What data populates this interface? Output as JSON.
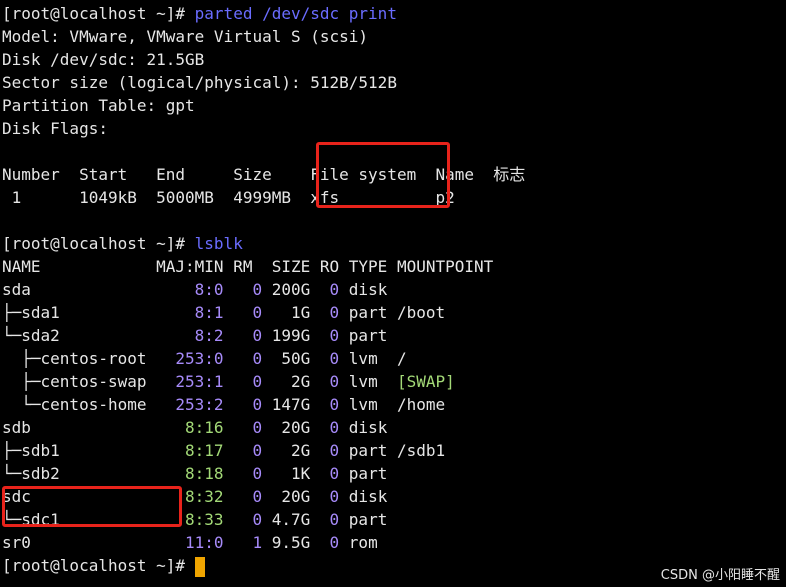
{
  "prompt": "[root@localhost ~]# ",
  "cmd1": "parted /dev/sdc print",
  "parted": {
    "model": "Model: VMware, VMware Virtual S (scsi)",
    "disk": "Disk /dev/sdc: 21.5GB",
    "sector": "Sector size (logical/physical): 512B/512B",
    "ptable": "Partition Table: gpt",
    "flags": "Disk Flags:",
    "header": "Number  Start   End     Size    File system  Name  标志",
    "row": " 1      1049kB  5000MB  4999MB  xfs          p2"
  },
  "cmd2": "lsblk",
  "lsblk": {
    "header": "NAME            MAJ:MIN RM  SIZE RO TYPE MOUNTPOINT",
    "rows": [
      {
        "name": "sda",
        "majmin": "8:0",
        "rm": "0",
        "size": "200G",
        "ro": "0",
        "type": "disk",
        "mount": ""
      },
      {
        "name": "├─sda1",
        "majmin": "8:1",
        "rm": "0",
        "size": "1G",
        "ro": "0",
        "type": "part",
        "mount": "/boot"
      },
      {
        "name": "└─sda2",
        "majmin": "8:2",
        "rm": "0",
        "size": "199G",
        "ro": "0",
        "type": "part",
        "mount": ""
      },
      {
        "name": "  ├─centos-root",
        "majmin": "253:0",
        "rm": "0",
        "size": "50G",
        "ro": "0",
        "type": "lvm",
        "mount": "/"
      },
      {
        "name": "  ├─centos-swap",
        "majmin": "253:1",
        "rm": "0",
        "size": "2G",
        "ro": "0",
        "type": "lvm",
        "mount": "[SWAP]"
      },
      {
        "name": "  └─centos-home",
        "majmin": "253:2",
        "rm": "0",
        "size": "147G",
        "ro": "0",
        "type": "lvm",
        "mount": "/home"
      },
      {
        "name": "sdb",
        "majmin": "8:16",
        "rm": "0",
        "size": "20G",
        "ro": "0",
        "type": "disk",
        "mount": ""
      },
      {
        "name": "├─sdb1",
        "majmin": "8:17",
        "rm": "0",
        "size": "2G",
        "ro": "0",
        "type": "part",
        "mount": "/sdb1"
      },
      {
        "name": "└─sdb2",
        "majmin": "8:18",
        "rm": "0",
        "size": "1K",
        "ro": "0",
        "type": "part",
        "mount": ""
      },
      {
        "name": "sdc",
        "majmin": "8:32",
        "rm": "0",
        "size": "20G",
        "ro": "0",
        "type": "disk",
        "mount": ""
      },
      {
        "name": "└─sdc1",
        "majmin": "8:33",
        "rm": "0",
        "size": "4.7G",
        "ro": "0",
        "type": "part",
        "mount": ""
      },
      {
        "name": "sr0",
        "majmin": "11:0",
        "rm": "1",
        "size": "9.5G",
        "ro": "0",
        "type": "rom",
        "mount": ""
      }
    ]
  },
  "watermark": "CSDN @小阳睡不醒",
  "colors": {
    "command": "#6a6cff",
    "number": "#a78bfa",
    "highlight": "#e8231b",
    "cursor": "#f0a500"
  }
}
